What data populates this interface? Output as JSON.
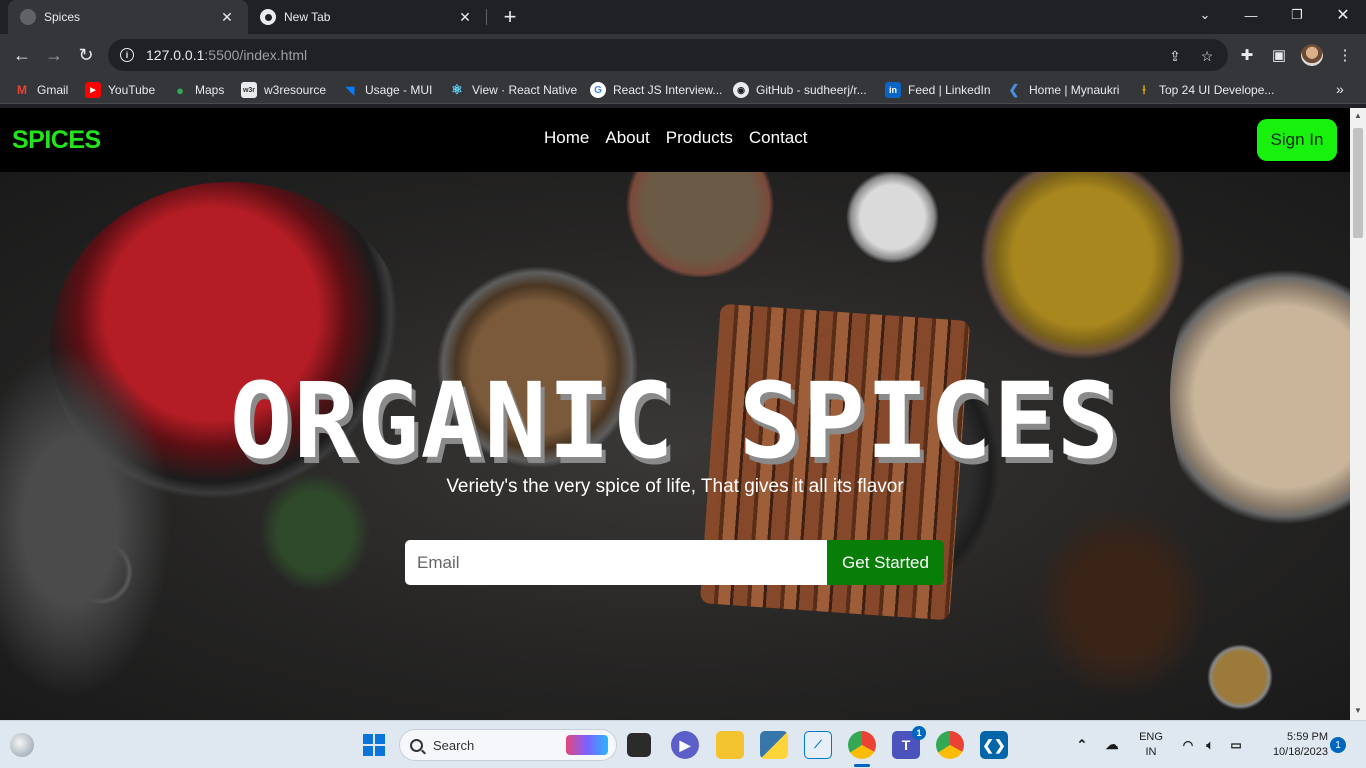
{
  "browser": {
    "tabs": [
      {
        "title": "Spices",
        "active": true
      },
      {
        "title": "New Tab",
        "active": false
      }
    ],
    "url_host": "127.0.0.1",
    "url_path": ":5500/index.html",
    "bookmarks": [
      {
        "label": "Gmail",
        "icon": "gmail-icon",
        "color": "#ea4335"
      },
      {
        "label": "YouTube",
        "icon": "youtube-icon",
        "color": "#ff0000"
      },
      {
        "label": "Maps",
        "icon": "maps-icon",
        "color": "#34a853"
      },
      {
        "label": "w3resource",
        "icon": "w3resource-icon",
        "color": "#e8eaed"
      },
      {
        "label": "Usage - MUI",
        "icon": "mui-icon",
        "color": "#007fff"
      },
      {
        "label": "View · React Native",
        "icon": "react-icon",
        "color": "#61dafb"
      },
      {
        "label": "React JS Interview...",
        "icon": "google-icon",
        "color": "#ffffff"
      },
      {
        "label": "GitHub - sudheerj/r...",
        "icon": "github-icon",
        "color": "#e8eaed"
      },
      {
        "label": "Feed | LinkedIn",
        "icon": "linkedin-icon",
        "color": "#0a66c2"
      },
      {
        "label": "Home | Mynaukri",
        "icon": "mynaukri-icon",
        "color": "#4a90e2"
      },
      {
        "label": "Top 24 UI Develope...",
        "icon": "bookmark-page-icon",
        "color": "#f0b400"
      }
    ]
  },
  "site": {
    "brand": "SPICES",
    "menu": [
      "Home",
      "About",
      "Products",
      "Contact"
    ],
    "signin_label": "Sign In",
    "hero_title": "ORGANIC SPICES",
    "hero_subtitle": "Veriety's the very spice of life, That gives it all its flavor",
    "email_placeholder": "Email",
    "cta_label": "Get Started",
    "colors": {
      "brand": "#23e51b",
      "signin_bg": "#18f00e",
      "cta_bg": "#087e08",
      "nav_bg": "#000000"
    }
  },
  "taskbar": {
    "search_label": "Search",
    "teams_badge": "1",
    "lang_line1": "ENG",
    "lang_line2": "IN",
    "time": "5:59 PM",
    "date": "10/18/2023",
    "notification_count": "1"
  }
}
